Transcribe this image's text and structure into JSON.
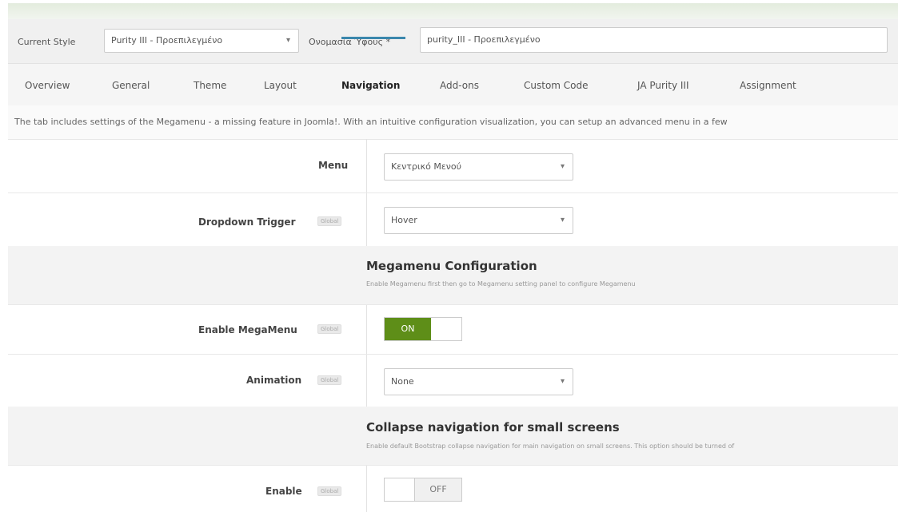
{
  "style_bar": {
    "current_style_label": "Current Style",
    "current_style_value": "Purity III - Προεπιλεγμένο",
    "style_name_label": "Ονομασία Ύφους *",
    "style_name_value": "purity_III - Προεπιλεγμένο"
  },
  "tabs": [
    {
      "label": "Overview"
    },
    {
      "label": "General"
    },
    {
      "label": "Theme"
    },
    {
      "label": "Layout"
    },
    {
      "label": "Navigation"
    },
    {
      "label": "Add-ons"
    },
    {
      "label": "Custom Code"
    },
    {
      "label": "JA Purity III"
    },
    {
      "label": "Assignment"
    }
  ],
  "active_tab": "Navigation",
  "description": "The tab includes settings of the Megamenu - a missing feature in Joomla!. With an intuitive configuration visualization, you can setup an advanced menu in a few",
  "badge_text": "Global",
  "fields": {
    "menu": {
      "label": "Menu",
      "value": "Κεντρικό Μενού"
    },
    "dropdown_trigger": {
      "label": "Dropdown Trigger",
      "value": "Hover"
    },
    "megamenu_section": {
      "title": "Megamenu Configuration",
      "desc": "Enable Megamenu first then go to Megamenu setting panel to configure Megamenu"
    },
    "enable_megamenu": {
      "label": "Enable MegaMenu",
      "state": "ON"
    },
    "animation": {
      "label": "Animation",
      "value": "None"
    },
    "collapse_section": {
      "title": "Collapse navigation for small screens",
      "desc": "Enable default Bootstrap collapse navigation for main navigation on small screens. This option should be turned of"
    },
    "enable_collapse": {
      "label": "Enable",
      "state": "OFF"
    }
  },
  "colors": {
    "accent": "#3a87ad",
    "toggle_on": "#5e8e18"
  }
}
